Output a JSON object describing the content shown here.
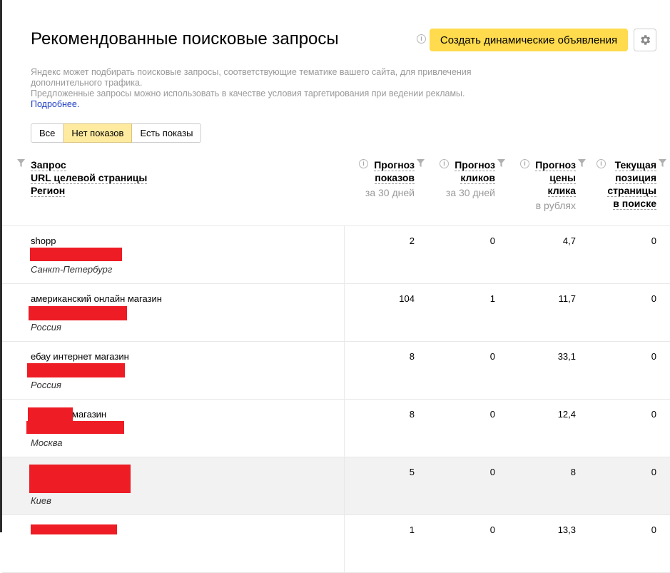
{
  "page": {
    "title": "Рекомендованные поисковые запросы",
    "create_button": "Создать динамические объявления",
    "description_line1": "Яндекс может подбирать поисковые запросы, соответствующие тематике вашего сайта, для привлечения дополнительного трафика.",
    "description_line2": "Предложенные запросы можно использовать в качестве условия таргетирования при ведении рекламы.",
    "more_link": "Подробнее",
    "more_suffix": "."
  },
  "filters": {
    "all": "Все",
    "no_impressions": "Нет показов",
    "has_impressions": "Есть показы",
    "active": "no_impressions"
  },
  "columns": {
    "query": [
      "Запрос",
      "URL целевой страницы",
      "Регион"
    ],
    "impressions": {
      "line1": "Прогноз",
      "line2": "показов",
      "sub": "за 30 дней"
    },
    "clicks": {
      "line1": "Прогноз",
      "line2": "кликов",
      "sub": "за 30 дней"
    },
    "price": {
      "line1": "Прогноз",
      "line2": "цены",
      "line3": "клика",
      "sub": "в рублях"
    },
    "position": {
      "line1": "Текущая",
      "line2": "позиция",
      "line3": "страницы",
      "line4": "в поиске"
    }
  },
  "rows": [
    {
      "query": "shopp",
      "region": "Санкт-Петербург",
      "impressions": "2",
      "clicks": "0",
      "price": "4,7",
      "position": "0"
    },
    {
      "query": "американский онлайн магазин",
      "region": "Россия",
      "impressions": "104",
      "clicks": "1",
      "price": "11,7",
      "position": "0"
    },
    {
      "query": "ебау интернет магазин",
      "region": "Россия",
      "impressions": "8",
      "clicks": "0",
      "price": "33,1",
      "position": "0"
    },
    {
      "query": "магазин",
      "region": "Москва",
      "impressions": "8",
      "clicks": "0",
      "price": "12,4",
      "position": "0"
    },
    {
      "query": "",
      "region": "Киев",
      "impressions": "5",
      "clicks": "0",
      "price": "8",
      "position": "0"
    },
    {
      "query": "",
      "region": "",
      "impressions": "1",
      "clicks": "0",
      "price": "13,3",
      "position": "0"
    }
  ],
  "colors": {
    "accent_button": "#ffdb4d",
    "active_tab": "#ffeba0",
    "link": "#1d3cc6",
    "redaction": "#ee1c25"
  },
  "icons": {
    "info": "info-icon",
    "settings": "gear-icon",
    "filter": "funnel-icon"
  }
}
